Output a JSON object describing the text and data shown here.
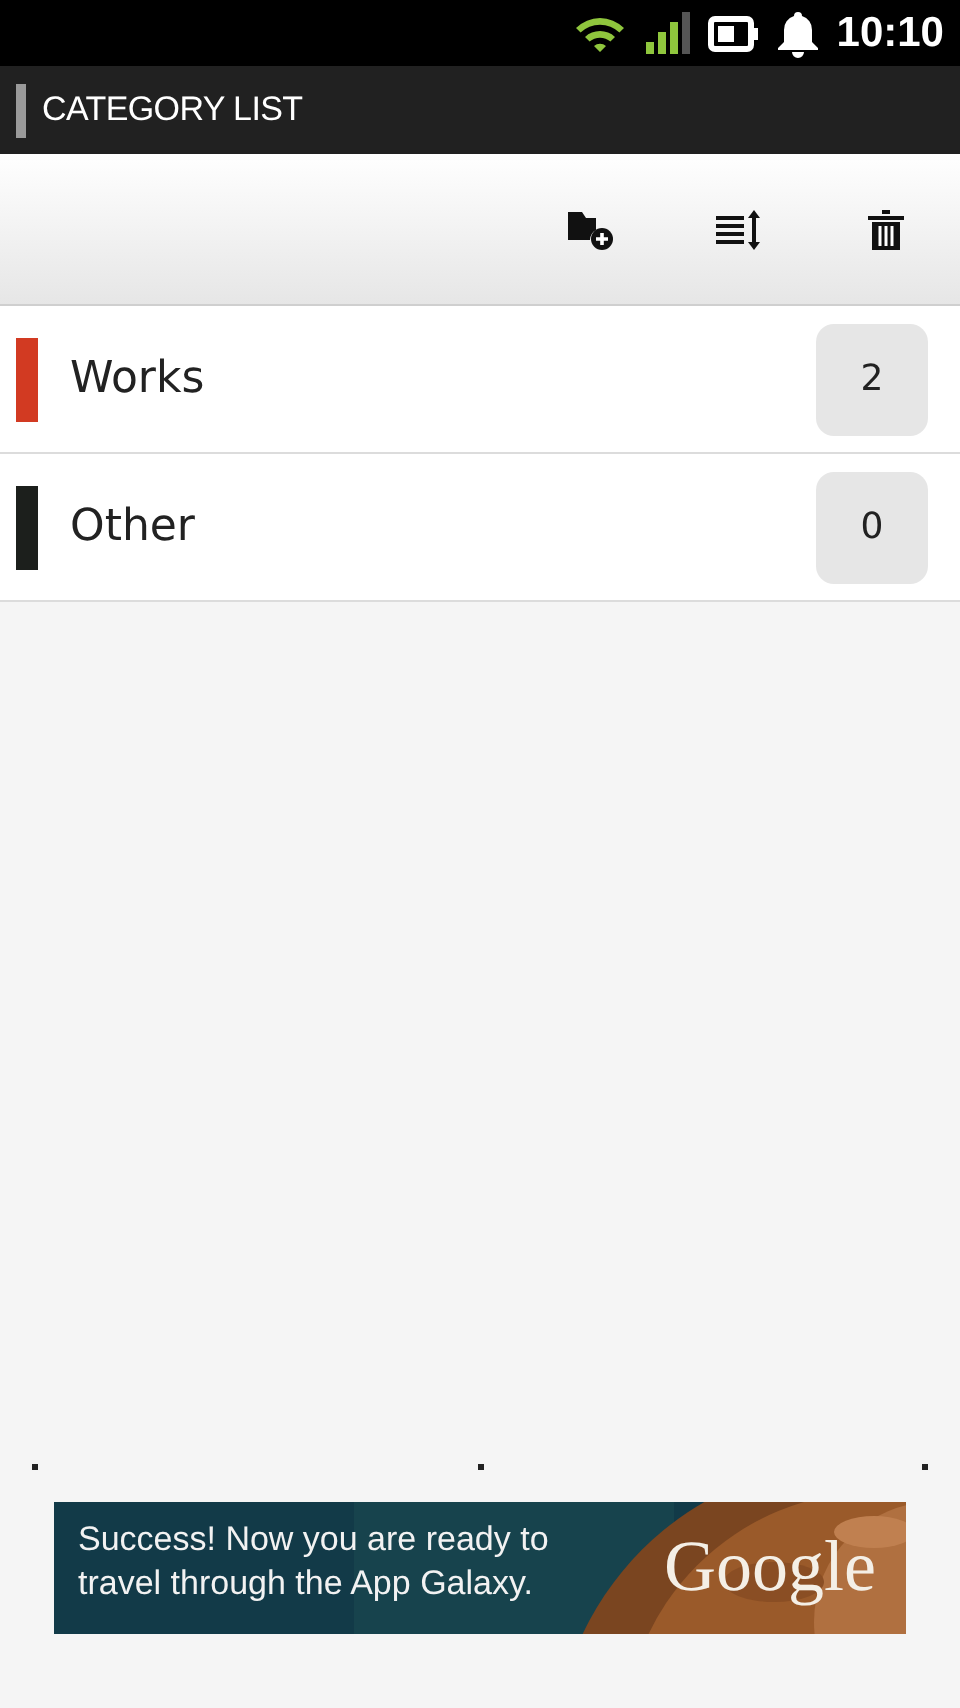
{
  "status_bar": {
    "time": "10:10"
  },
  "title_bar": {
    "title": "CATEGORY LIST"
  },
  "categories": [
    {
      "name": "Works",
      "count": "2",
      "color": "#d23a22"
    },
    {
      "name": "Other",
      "count": "0",
      "color": "#1c1f1c"
    }
  ],
  "ad_banner": {
    "message": "Success! Now you are ready to travel through the App Galaxy.",
    "brand": "Google"
  }
}
